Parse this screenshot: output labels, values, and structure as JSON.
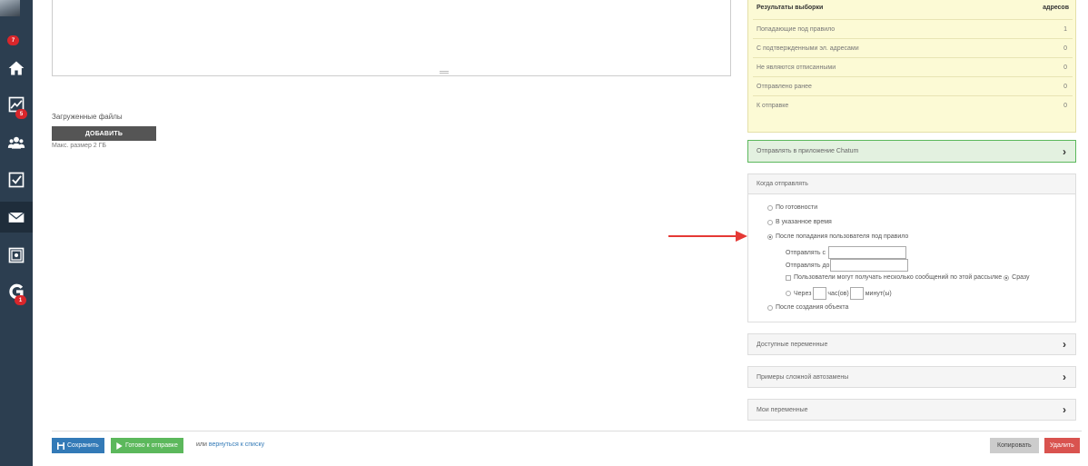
{
  "sidebar": {
    "badges": {
      "notifications": "7",
      "stats": "5",
      "chat": "1"
    }
  },
  "files": {
    "label": "Загруженные файлы",
    "add_button": "ДОБАВИТЬ",
    "max_size": "Макс. размер 2 ГБ"
  },
  "results": {
    "title": "Результаты выборки",
    "unit": "адресов",
    "rows": [
      {
        "label": "Попадающие под правило",
        "value": "1"
      },
      {
        "label": "С подтвержденными эл. адресами",
        "value": "0"
      },
      {
        "label": "Не являются отписанными",
        "value": "0"
      },
      {
        "label": "Отправлено ранее",
        "value": "0"
      },
      {
        "label": "К отправке",
        "value": "0"
      }
    ]
  },
  "panels": {
    "chatum": "Отправлять в приложение Chatum",
    "variables": "Доступные переменные",
    "examples": "Примеры сложной автозамены",
    "my_variables": "Мои переменные"
  },
  "when": {
    "title": "Когда отправлять",
    "options": {
      "ready": "По готовности",
      "at_time": "В указанное время",
      "after_rule": "После попадания пользователя под правило",
      "after_create": "После создания объекта"
    },
    "send_from": "Отправлять с",
    "send_to": "Отправлять до",
    "multiple": "Пользователи могут получать несколько сообщений по этой рассылке",
    "immediately": "Сразу",
    "after": "Через",
    "hours": "час(ов)",
    "minutes": "минут(ы)",
    "selected": "after_rule"
  },
  "footer": {
    "save": "Сохранить",
    "ready": "Готово к отправке",
    "or": "или",
    "back": "вернуться к списку",
    "copy": "Копировать",
    "delete": "Удалить"
  },
  "colors": {
    "sidebar": "#2c3e50",
    "results_bg": "#fcfad5",
    "save": "#337ab7",
    "ready": "#5cb85c",
    "delete": "#d9534f",
    "arrow": "#e53935"
  }
}
